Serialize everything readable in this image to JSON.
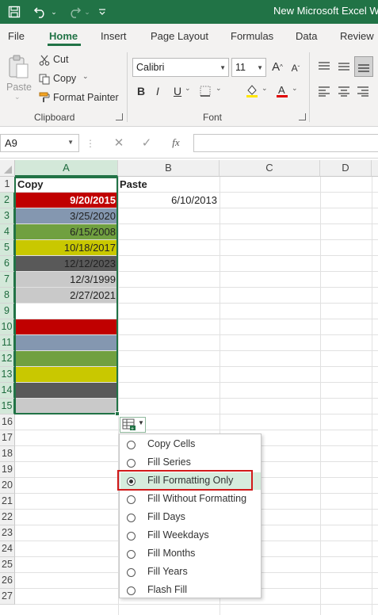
{
  "window": {
    "title": "New Microsoft Excel Wor"
  },
  "quick_access": {
    "icons": [
      "save-icon",
      "undo-icon",
      "redo-icon",
      "customize-icon"
    ]
  },
  "tabs": [
    {
      "label": "File"
    },
    {
      "label": "Home",
      "active": true
    },
    {
      "label": "Insert"
    },
    {
      "label": "Page Layout"
    },
    {
      "label": "Formulas"
    },
    {
      "label": "Data"
    },
    {
      "label": "Review"
    }
  ],
  "clipboard": {
    "paste_label": "Paste",
    "cut_label": "Cut",
    "copy_label": "Copy",
    "format_painter_label": "Format Painter",
    "group_label": "Clipboard"
  },
  "font": {
    "name": "Calibri",
    "size": "11",
    "group_label": "Font",
    "bold": "B",
    "italic": "I",
    "underline": "U"
  },
  "formula_bar": {
    "name_box": "A9",
    "fx_label": "fx",
    "value": ""
  },
  "columns": [
    "A",
    "B",
    "C",
    "D"
  ],
  "rows": [
    "1",
    "2",
    "3",
    "4",
    "5",
    "6",
    "7",
    "8",
    "9",
    "10",
    "11",
    "12",
    "13",
    "14",
    "15",
    "16",
    "17",
    "18",
    "19",
    "20",
    "21",
    "22",
    "23",
    "24",
    "25",
    "26",
    "27"
  ],
  "cells": {
    "A1": "Copy",
    "B1": "Paste",
    "A2": "9/20/2015",
    "A3": "3/25/2020",
    "A4": "6/15/2008",
    "A5": "10/18/2017",
    "A6": "12/12/2023",
    "A7": "12/3/1999",
    "A8": "2/27/2021",
    "B2": "6/10/2013"
  },
  "fill_colors": {
    "red": "#c00000",
    "blue_gray": "#8497b0",
    "green": "#70a040",
    "yellow": "#c9c800",
    "dark_gray": "#595959",
    "light_gray": "#c9c9c9",
    "text_white": "#ffffff",
    "accent": "#217346",
    "highlight_box": "#d11a1a"
  },
  "autofill_menu": {
    "items": [
      {
        "label": "Copy Cells",
        "checked": false
      },
      {
        "label": "Fill Series",
        "checked": false
      },
      {
        "label": "Fill Formatting Only",
        "checked": true
      },
      {
        "label": "Fill Without Formatting",
        "checked": false
      },
      {
        "label": "Fill Days",
        "checked": false
      },
      {
        "label": "Fill Weekdays",
        "checked": false
      },
      {
        "label": "Fill Months",
        "checked": false
      },
      {
        "label": "Fill Years",
        "checked": false
      },
      {
        "label": "Flash Fill",
        "checked": false
      }
    ]
  }
}
